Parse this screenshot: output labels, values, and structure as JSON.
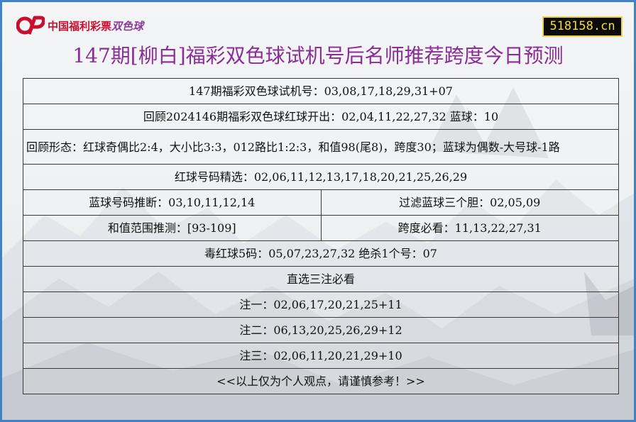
{
  "header": {
    "logo_text_red": "中国福利彩票",
    "logo_text_purple": "双色球",
    "site": "518158.cn",
    "title": "147期[柳白]福彩双色球试机号后名师推荐跨度今日预测"
  },
  "rows": {
    "test_numbers": "147期福彩双色球试机号：03,08,17,18,29,31+07",
    "review": "回顾2024146期福彩双色球红球开出：02,04,11,22,27,32 蓝球：10",
    "pattern": "回顾形态：红球奇偶比2:4，大小比3:3，012路比1:2:3，和值98(尾8)，跨度30；蓝球为偶数-大号球-1路",
    "red_pick": "红球号码精选：02,06,11,12,13,17,18,20,21,25,26,29",
    "blue_judge": "蓝球号码推断：03,10,11,12,14",
    "blue_filter": "过滤蓝球三个胆：02,05,09",
    "sum_range": "和值范围推测：[93-109]",
    "span_pick": "跨度必看：11,13,22,27,31",
    "poison": "毒红球5码：05,07,23,27,32 绝杀1个号：07",
    "direct_title": "直选三注必看",
    "bet1": "注一：02,06,17,20,21,25+11",
    "bet2": "注二：06,13,20,25,26,29+12",
    "bet3": "注三：02,06,11,20,21,29+10",
    "disclaimer": "<<以上仅为个人观点，请谨慎参考！>>"
  },
  "colors": {
    "frame": "#3f82c6",
    "title": "#8a2d96",
    "logo_red": "#c8102e",
    "badge_text": "#f6d836"
  }
}
